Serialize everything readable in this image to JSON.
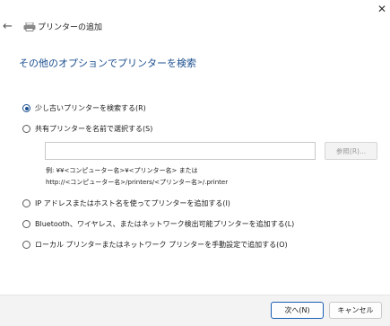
{
  "window": {
    "title": "プリンターの追加",
    "close_glyph": "✕",
    "back_glyph": "←"
  },
  "page": {
    "heading": "その他のオプションでプリンターを検索"
  },
  "options": [
    {
      "label": "少し古いプリンターを検索する(R)",
      "checked": true
    },
    {
      "label": "共有プリンターを名前で選択する(S)",
      "checked": false
    },
    {
      "label": "IP アドレスまたはホスト名を使ってプリンターを追加する(I)",
      "checked": false
    },
    {
      "label": "Bluetooth、ワイヤレス、またはネットワーク検出可能プリンターを追加する(L)",
      "checked": false
    },
    {
      "label": "ローカル プリンターまたはネットワーク プリンターを手動設定で追加する(O)",
      "checked": false
    }
  ],
  "share": {
    "value": "",
    "browse_label": "参照(R)...",
    "example_line1": "例: ¥¥<コンピューター名>¥<プリンター名> または",
    "example_line2": "http://<コンピューター名>/printers/<プリンター名>/.printer"
  },
  "footer": {
    "next_label": "次へ(N)",
    "cancel_label": "キャンセル"
  },
  "colors": {
    "accent": "#1a4e8f",
    "primary_border": "#1a5fb4",
    "footer_bg": "#f3f3f3"
  }
}
